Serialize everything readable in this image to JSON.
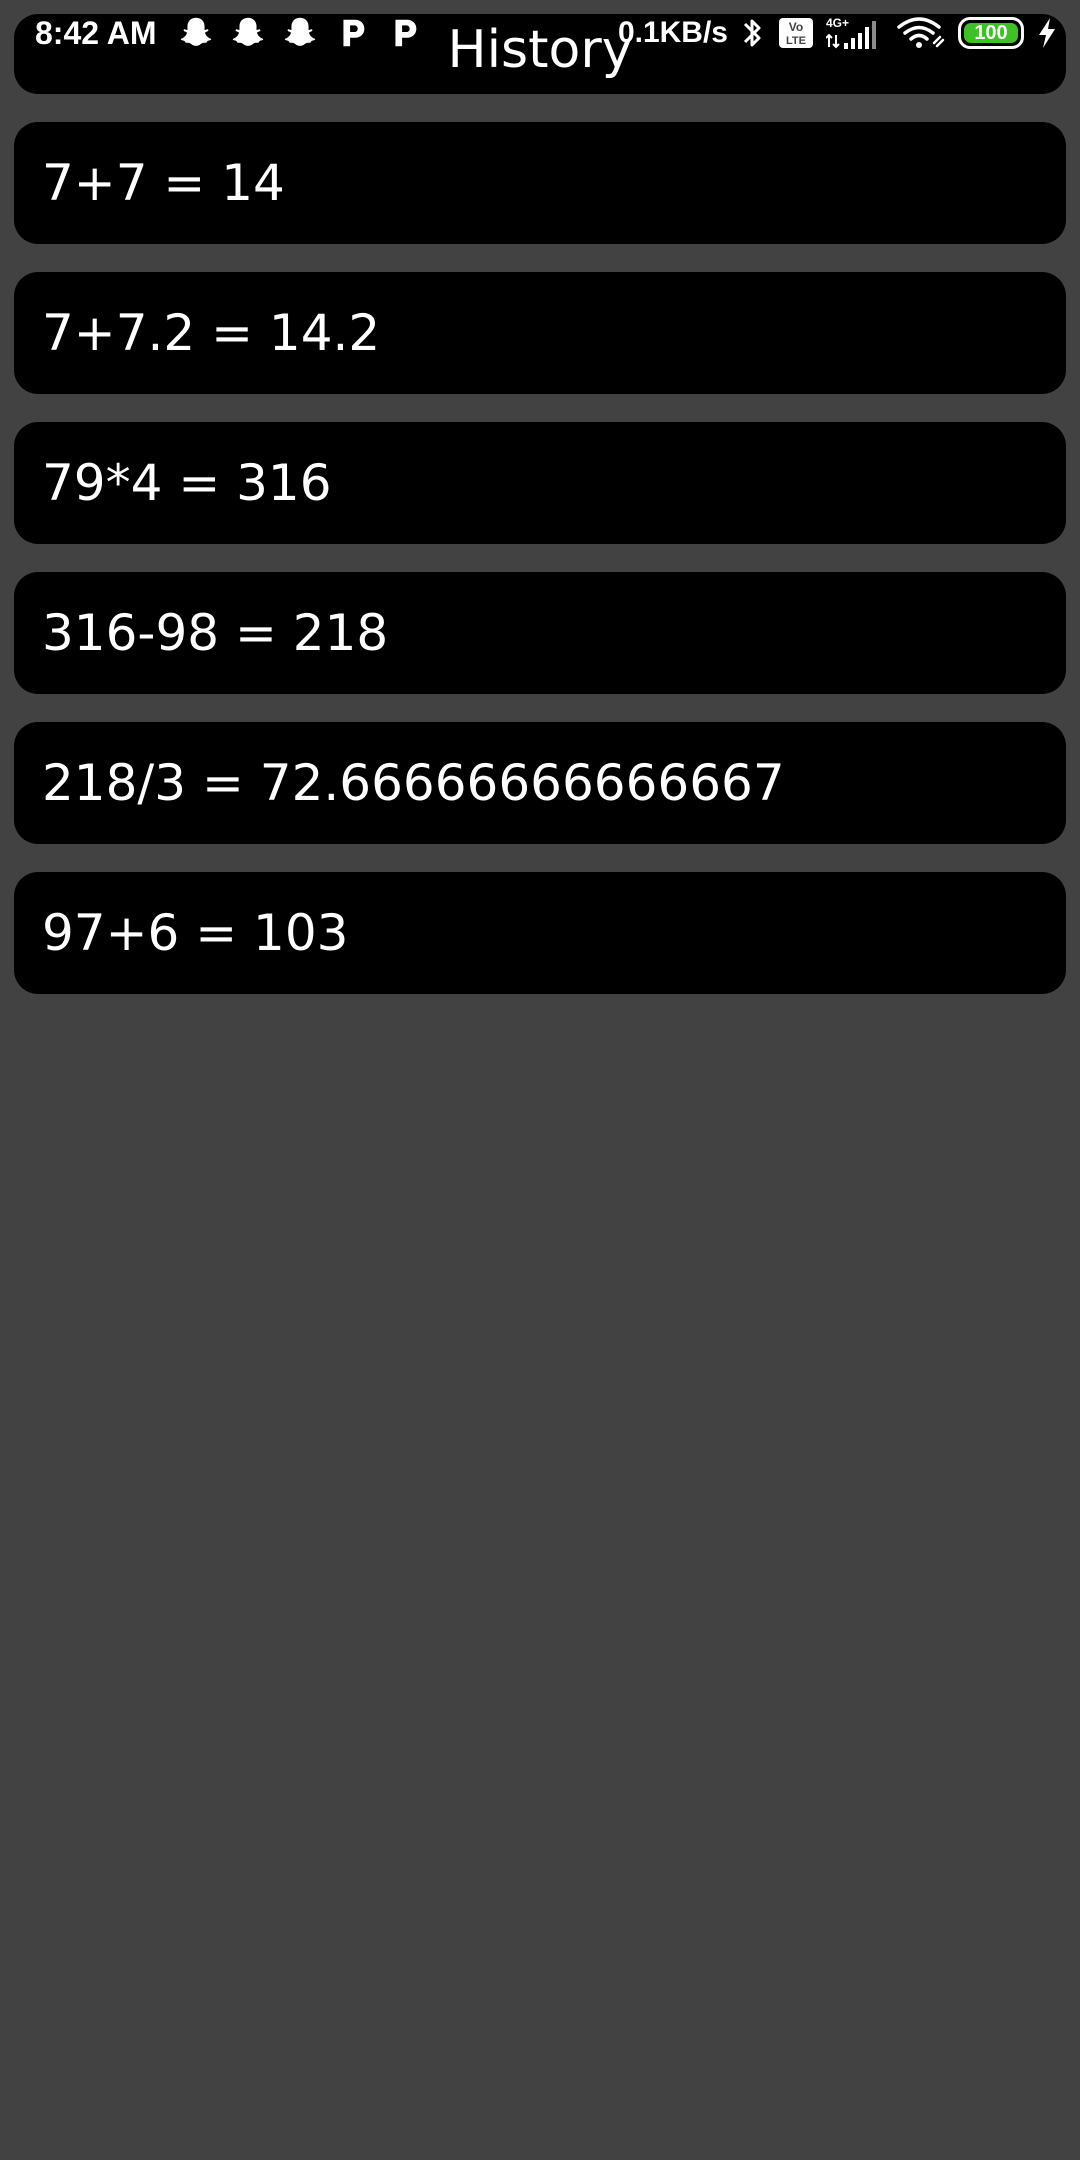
{
  "header": {
    "title": "History"
  },
  "status_bar": {
    "time": "8:42 AM",
    "left_icons": [
      "snapchat-icon",
      "snapchat-icon",
      "snapchat-icon",
      "p-app-icon",
      "p-app-icon"
    ],
    "net_speed": "0.1KB/s",
    "right_icons": [
      "bluetooth-icon",
      "volte-icon",
      "4g-signal-icon",
      "wifi-icon"
    ],
    "battery_level": "100",
    "battery_color": "#3fbf28"
  },
  "history": {
    "items": [
      {
        "text": "7+7 = 14"
      },
      {
        "text": "7+7.2 = 14.2"
      },
      {
        "text": "79*4 = 316"
      },
      {
        "text": "316-98 = 218"
      },
      {
        "text": "218/3 = 72.66666666666667"
      },
      {
        "text": "97+6 = 103"
      }
    ]
  },
  "colors": {
    "background": "#424242",
    "card": "#000000",
    "text": "#ffffff"
  }
}
